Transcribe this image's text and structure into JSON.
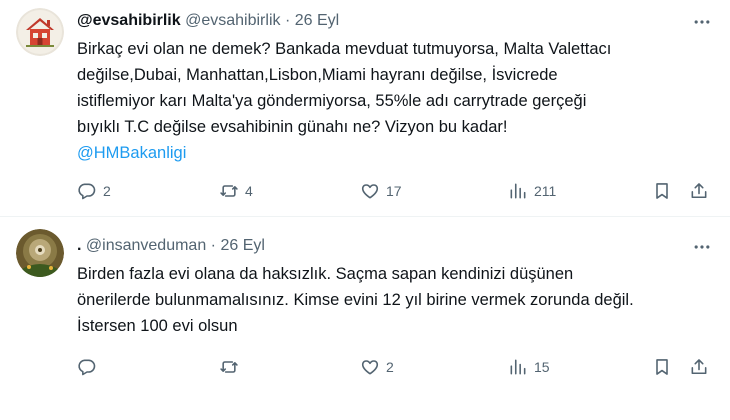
{
  "tweets": [
    {
      "name": "@evsahibirlik",
      "handle": "@evsahibirlik",
      "dot": "·",
      "date": "26 Eyl",
      "lines": [
        "Birkaç evi olan ne demek? Bankada mevduat tutmuyorsa, Malta Valettacı",
        "değilse,Dubai, Manhattan,Lisbon,Miami hayranı değilse, İsvicrede",
        "istiflemiyor karı Malta'ya göndermiyorsa, 55%le adı carrytrade gerçeği",
        "bıyıklı T.C değilse evsahibinin günahı ne? Vizyon bu kadar!"
      ],
      "mention": "@HMBakanligi",
      "replies": "2",
      "retweets": "4",
      "likes": "17",
      "views": "211"
    },
    {
      "name": ".",
      "handle": "@insanveduman",
      "dot": "·",
      "date": "26 Eyl",
      "lines": [
        "Birden fazla evi olana da haksızlık. Saçma sapan kendinizi düşünen",
        "önerilerde bulunmamalısınız. Kimse evini 12 yıl birine vermek zorunda değil.",
        "İstersen 100 evi olsun"
      ],
      "replies": "",
      "retweets": "",
      "likes": "2",
      "views": "15"
    }
  ],
  "icons": {
    "reply": "reply-icon",
    "retweet": "retweet-icon",
    "like": "heart-icon",
    "views": "views-icon",
    "bookmark": "bookmark-icon",
    "share": "share-icon",
    "more": "more-icon"
  },
  "colors": {
    "link": "#1d9bf0",
    "secondary_text": "#536471",
    "primary_text": "#0f1419"
  }
}
